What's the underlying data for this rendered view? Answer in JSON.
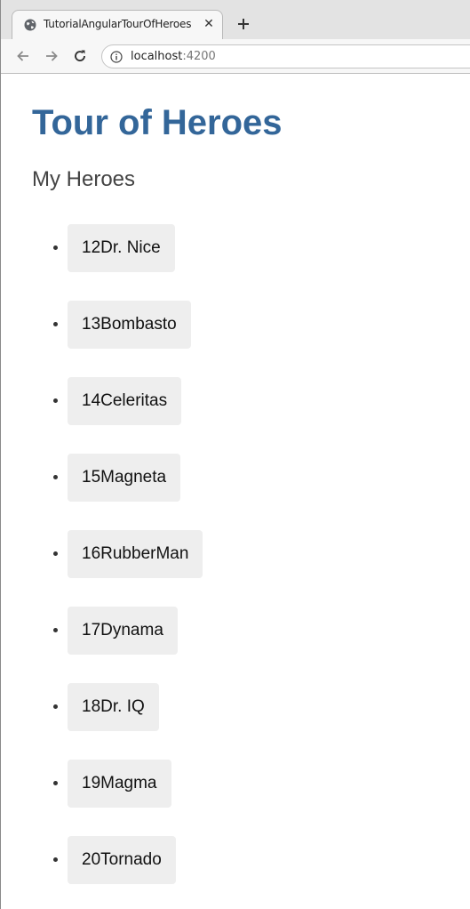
{
  "browser": {
    "tab": {
      "title": "TutorialAngularTourOfHeroes",
      "close_glyph": "✕",
      "favicon_icon": "globe-icon"
    },
    "new_tab_icon": "plus-icon",
    "nav": {
      "back_icon": "arrow-left-icon",
      "forward_icon": "arrow-right-icon",
      "reload_icon": "reload-icon"
    },
    "address": {
      "info_icon": "info-icon",
      "host": "localhost",
      "port": ":4200"
    }
  },
  "page": {
    "title": "Tour of Heroes",
    "subtitle": "My Heroes",
    "title_color": "#336699",
    "heroes": [
      {
        "id": "12",
        "name": "Dr. Nice"
      },
      {
        "id": "13",
        "name": "Bombasto"
      },
      {
        "id": "14",
        "name": "Celeritas"
      },
      {
        "id": "15",
        "name": "Magneta"
      },
      {
        "id": "16",
        "name": "RubberMan"
      },
      {
        "id": "17",
        "name": "Dynama"
      },
      {
        "id": "18",
        "name": "Dr. IQ"
      },
      {
        "id": "19",
        "name": "Magma"
      },
      {
        "id": "20",
        "name": "Tornado"
      }
    ]
  }
}
